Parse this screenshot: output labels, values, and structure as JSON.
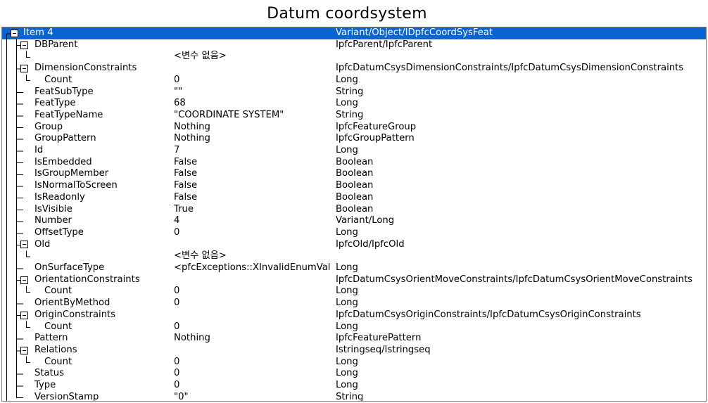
{
  "window_title": "Datum coordsystem",
  "rows": [
    {
      "name": "Item 4",
      "value": "",
      "type": "Variant/Object/IDpfcCoordSysFeat",
      "level": 0,
      "expander": true,
      "selected": true
    },
    {
      "name": "DBParent",
      "value": "",
      "type": "IpfcParent/IpfcParent",
      "level": 1,
      "expander": true
    },
    {
      "name": "",
      "value": "<변수 없음>",
      "type": "",
      "level": 2,
      "expander": false
    },
    {
      "name": "DimensionConstraints",
      "value": "",
      "type": "IpfcDatumCsysDimensionConstraints/IpfcDatumCsysDimensionConstraints",
      "level": 1,
      "expander": true
    },
    {
      "name": "Count",
      "value": "0",
      "type": "Long",
      "level": 2,
      "expander": false
    },
    {
      "name": "FeatSubType",
      "value": "\"\"",
      "type": "String",
      "level": 1,
      "expander": false
    },
    {
      "name": "FeatType",
      "value": "68",
      "type": "Long",
      "level": 1,
      "expander": false
    },
    {
      "name": "FeatTypeName",
      "value": "\"COORDINATE SYSTEM\"",
      "type": "String",
      "level": 1,
      "expander": false
    },
    {
      "name": "Group",
      "value": "Nothing",
      "type": "IpfcFeatureGroup",
      "level": 1,
      "expander": false
    },
    {
      "name": "GroupPattern",
      "value": "Nothing",
      "type": "IpfcGroupPattern",
      "level": 1,
      "expander": false
    },
    {
      "name": "Id",
      "value": "7",
      "type": "Long",
      "level": 1,
      "expander": false
    },
    {
      "name": "IsEmbedded",
      "value": "False",
      "type": "Boolean",
      "level": 1,
      "expander": false
    },
    {
      "name": "IsGroupMember",
      "value": "False",
      "type": "Boolean",
      "level": 1,
      "expander": false
    },
    {
      "name": "IsNormalToScreen",
      "value": "False",
      "type": "Boolean",
      "level": 1,
      "expander": false
    },
    {
      "name": "IsReadonly",
      "value": "False",
      "type": "Boolean",
      "level": 1,
      "expander": false
    },
    {
      "name": "IsVisible",
      "value": "True",
      "type": "Boolean",
      "level": 1,
      "expander": false
    },
    {
      "name": "Number",
      "value": "4",
      "type": "Variant/Long",
      "level": 1,
      "expander": false
    },
    {
      "name": "OffsetType",
      "value": "0",
      "type": "Long",
      "level": 1,
      "expander": false
    },
    {
      "name": "Old",
      "value": "",
      "type": "IpfcOld/IpfcOld",
      "level": 1,
      "expander": true
    },
    {
      "name": "",
      "value": "<변수 없음>",
      "type": "",
      "level": 2,
      "expander": false
    },
    {
      "name": "OnSurfaceType",
      "value": "<pfcExceptions::XInvalidEnumVal",
      "type": "Long",
      "level": 1,
      "expander": false
    },
    {
      "name": "OrientationConstraints",
      "value": "",
      "type": "IpfcDatumCsysOrientMoveConstraints/IpfcDatumCsysOrientMoveConstraints",
      "level": 1,
      "expander": true
    },
    {
      "name": "Count",
      "value": "0",
      "type": "Long",
      "level": 2,
      "expander": false
    },
    {
      "name": "OrientByMethod",
      "value": "0",
      "type": "Long",
      "level": 1,
      "expander": false
    },
    {
      "name": "OriginConstraints",
      "value": "",
      "type": "IpfcDatumCsysOriginConstraints/IpfcDatumCsysOriginConstraints",
      "level": 1,
      "expander": true
    },
    {
      "name": "Count",
      "value": "0",
      "type": "Long",
      "level": 2,
      "expander": false
    },
    {
      "name": "Pattern",
      "value": "Nothing",
      "type": "IpfcFeaturePattern",
      "level": 1,
      "expander": false
    },
    {
      "name": "Relations",
      "value": "",
      "type": "Istringseq/Istringseq",
      "level": 1,
      "expander": true
    },
    {
      "name": "Count",
      "value": "0",
      "type": "Long",
      "level": 2,
      "expander": false
    },
    {
      "name": "Status",
      "value": "0",
      "type": "Long",
      "level": 1,
      "expander": false
    },
    {
      "name": "Type",
      "value": "0",
      "type": "Long",
      "level": 1,
      "expander": false
    },
    {
      "name": "VersionStamp",
      "value": "\"0\"",
      "type": "String",
      "level": 1,
      "expander": false
    }
  ]
}
